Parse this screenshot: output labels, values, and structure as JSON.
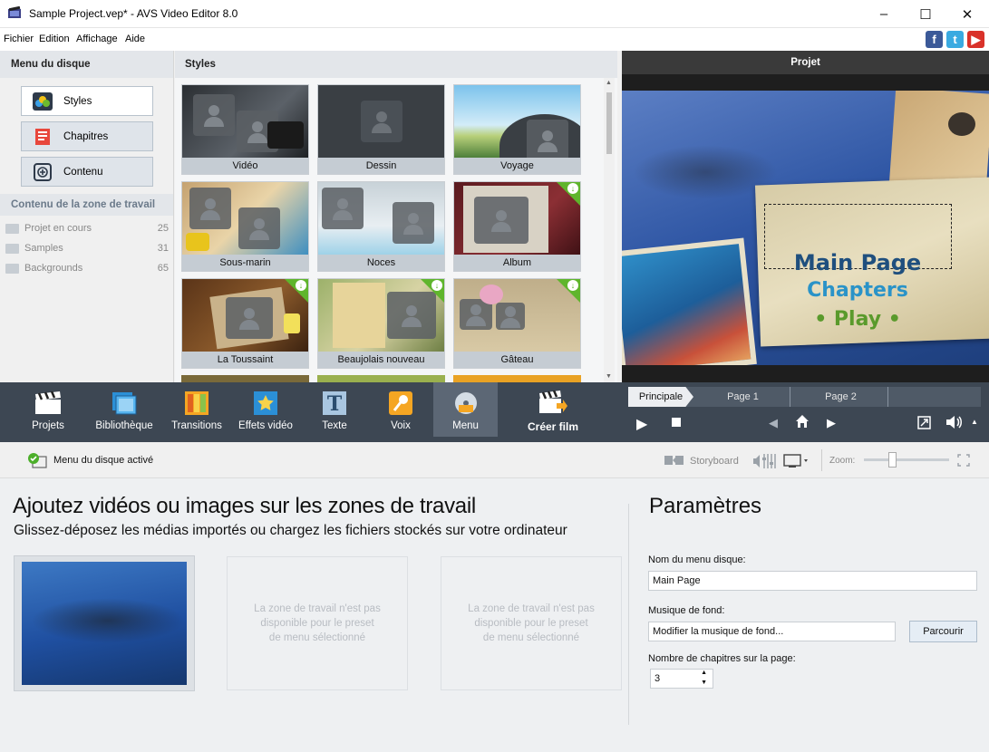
{
  "window": {
    "title": "Sample Project.vep* - AVS Video Editor 8.0"
  },
  "menu": [
    "Fichier",
    "Edition",
    "Affichage",
    "Aide"
  ],
  "left_panel": {
    "header": "Menu du disque",
    "buttons": [
      "Styles",
      "Chapitres",
      "Contenu"
    ],
    "section_title": "Contenu de la zone de travail",
    "folders": [
      {
        "name": "Projet en cours",
        "count": "25"
      },
      {
        "name": "Samples",
        "count": "31"
      },
      {
        "name": "Backgrounds",
        "count": "65"
      }
    ]
  },
  "styles_panel": {
    "header": "Styles",
    "items": [
      "Vidéo",
      "Dessin",
      "Voyage",
      "Sous-marin",
      "Noces",
      "Album",
      "La Toussaint",
      "Beaujolais nouveau",
      "Gâteau"
    ]
  },
  "preview": {
    "header": "Projet",
    "menu_lines": [
      "Main Page",
      "Chapters",
      "• Play •"
    ]
  },
  "toolbar": {
    "tools": [
      "Projets",
      "Bibliothèque",
      "Transitions",
      "Effets vidéo",
      "Texte",
      "Voix",
      "Menu"
    ],
    "create": "Créer film",
    "pages": [
      "Principale",
      "Page 1",
      "Page 2"
    ]
  },
  "infobar": {
    "disc_menu_active": "Menu du disque activé",
    "storyboard": "Storyboard",
    "zoom": "Zoom:"
  },
  "main": {
    "title": "Ajoutez vidéos ou images sur les zones de travail",
    "subtitle": "Glissez-déposez les médias importés ou chargez les fichiers stockés sur votre ordinateur",
    "zone_unavailable": [
      "La zone de travail  n'est pas",
      "disponible pour le preset",
      "de menu sélectionné"
    ]
  },
  "params": {
    "title": "Paramètres",
    "menu_name_label": "Nom du menu disque:",
    "menu_name_value": "Main Page",
    "music_label": "Musique de fond:",
    "music_value": "Modifier la musique de fond...",
    "browse": "Parcourir",
    "chapters_label": "Nombre de chapitres sur la page:",
    "chapters_value": "3"
  },
  "colors": {
    "toolbar_bg": "#3d4753",
    "active_tool": "#5c6775",
    "download_badge": "#5fb52c",
    "chapters_text": "#2a93c8",
    "play_text": "#5a9a2c"
  }
}
